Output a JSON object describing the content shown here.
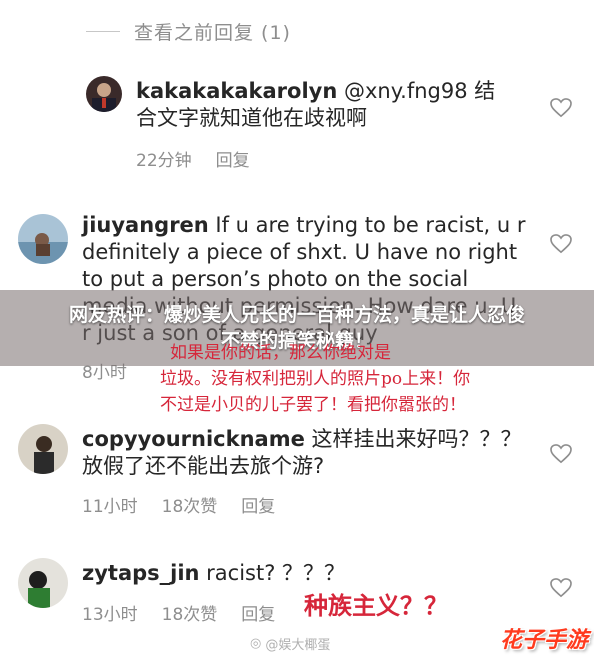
{
  "view_previous": "查看之前回复 (1)",
  "comments": [
    {
      "username": "kakakakakarolyn",
      "text": " @xny.fng98 结合文字就知道他在歧视啊",
      "time": "22分钟",
      "likes": "",
      "reply_label": "回复"
    },
    {
      "username": "jiuyangren",
      "text": " If u are trying to be racist, u r definitely a piece of shxt. U have no right to put a person’s photo on the social media without permission. How dare u. U r just a son of a general guy",
      "time": "8小时",
      "likes": "",
      "reply_label": "回复"
    },
    {
      "username": "copyyournickname",
      "text": " 这样挂出来好吗？？？放假了还不能出去旅个游?",
      "time": "11小时",
      "likes": "18次赞",
      "reply_label": "回复"
    },
    {
      "username": "zytaps_jin",
      "text": " racist? ？？？",
      "time": "13小时",
      "likes": "18次赞",
      "reply_label": "回复"
    }
  ],
  "banner": {
    "line1": "网友热评：爆炒美人兄长的一百种方法，真是让人忍俊",
    "line2": "不禁的搞笑秘籍！"
  },
  "annotation": {
    "line1": "如果是你的话，那么你绝对是",
    "line2": "垃圾。没有权利把别人的照片po上来！你",
    "line3": "不过是小贝的儿子罢了！看把你嚣张的！",
    "racism": "种族主义？？"
  },
  "watermark": "@娱大椰蛋",
  "site_logo": "花子手游",
  "colors": {
    "annotation_red": "#d6263a",
    "muted": "#8e8e8e"
  }
}
